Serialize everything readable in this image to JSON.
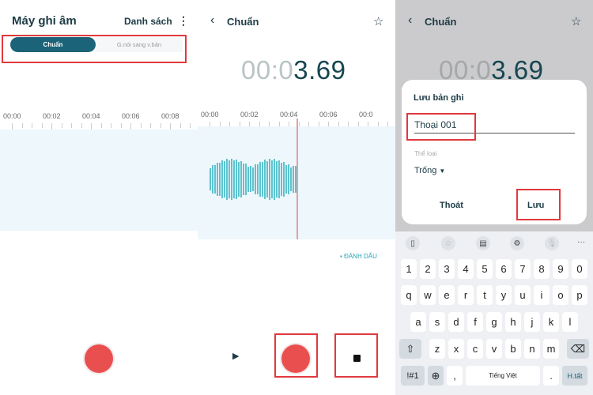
{
  "panel1": {
    "title": "Máy ghi âm",
    "list_button": "Danh sách",
    "more_icon": "more-vertical-icon",
    "tabs": [
      {
        "label": "Chuẩn",
        "active": true
      },
      {
        "label": "G.nói sang v.bản",
        "active": false
      }
    ],
    "timeline": [
      "00:00",
      "00:02",
      "00:04",
      "00:06",
      "00:08"
    ]
  },
  "panel2": {
    "title": "Chuẩn",
    "timer_dim": "00:0",
    "timer_bright": "3.69",
    "timeline": [
      "00:00",
      "00:02",
      "00:04",
      "00:06",
      "00:0"
    ],
    "bookmark_label": "ĐÁNH DẤU"
  },
  "panel3": {
    "title": "Chuẩn",
    "timer_dim": "00:0",
    "timer_bright": "3.69",
    "dialog": {
      "title": "Lưu bản ghi",
      "name_value": "Thoại 001",
      "category_label": "Thể loại",
      "category_value": "Trống",
      "cancel": "Thoát",
      "save": "Lưu"
    },
    "keyboard": {
      "numbers": [
        "1",
        "2",
        "3",
        "4",
        "5",
        "6",
        "7",
        "8",
        "9",
        "0"
      ],
      "row1": [
        "q",
        "w",
        "e",
        "r",
        "t",
        "y",
        "u",
        "i",
        "o",
        "p"
      ],
      "row2": [
        "a",
        "s",
        "d",
        "f",
        "g",
        "h",
        "j",
        "k",
        "l"
      ],
      "row3": [
        "z",
        "x",
        "c",
        "v",
        "b",
        "n",
        "m"
      ],
      "sym": "!#1",
      "comma": ",",
      "space": "Tiếng Việt",
      "period": ".",
      "done": "H.tất"
    }
  },
  "colors": {
    "accent": "#1b6378",
    "record": "#ea4f50",
    "highlight": "#e0393e",
    "wave": "#5ec3cf"
  }
}
